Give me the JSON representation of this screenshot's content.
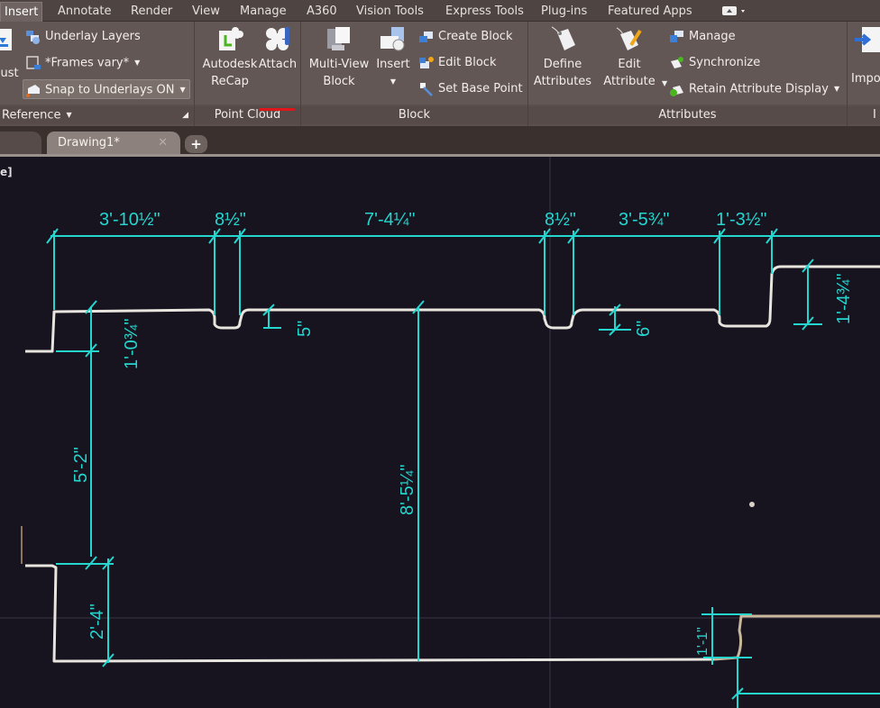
{
  "ribbon_tabs": [
    {
      "label": "Insert",
      "active": true
    },
    {
      "label": "Annotate"
    },
    {
      "label": "Render"
    },
    {
      "label": "View"
    },
    {
      "label": "Manage"
    },
    {
      "label": "A360"
    },
    {
      "label": "Vision Tools"
    },
    {
      "label": "Express Tools"
    },
    {
      "label": "Plug-ins"
    },
    {
      "label": "Featured Apps"
    }
  ],
  "panels": {
    "reference": {
      "title": "Reference",
      "adjust_label": "Adjust",
      "underlay_layers": "Underlay Layers",
      "frames": "*Frames vary*",
      "snap": "Snap to Underlays ON"
    },
    "point_cloud": {
      "title": "Point Cloud",
      "recap_line1": "Autodesk",
      "recap_line2": "ReCap",
      "attach": "Attach"
    },
    "block": {
      "title": "Block",
      "multiview_line1": "Multi-View",
      "multiview_line2": "Block",
      "insert": "Insert",
      "create_block": "Create Block",
      "edit_block": "Edit Block",
      "set_base_point": "Set Base Point"
    },
    "attributes": {
      "title": "Attributes",
      "define_line1": "Define",
      "define_line2": "Attributes",
      "edit_line1": "Edit",
      "edit_line2": "Attribute",
      "manage": "Manage",
      "synchronize": "Synchronize",
      "retain": "Retain Attribute Display"
    },
    "import": {
      "label": "Impo",
      "title": "I"
    }
  },
  "document_tabs": [
    {
      "label": "Drawing1*",
      "active": true
    }
  ],
  "new_tab_label": "+",
  "close_glyph": "✕",
  "viewport_label": "e]",
  "dimensions": {
    "top": [
      "3'-10½\"",
      "8½\"",
      "7'-4¼\"",
      "8½\"",
      "3'-5¾\"",
      "1'-3½\""
    ],
    "left_small": "1'-0¾\"",
    "notch_5": "5\"",
    "notch_6": "6\"",
    "right_step": "1'-4¾\"",
    "left_tall": "5'-2\"",
    "center_tall": "8'-5¼\"",
    "bottom_left": "2'-4\"",
    "bottom_right": "1'-1\""
  },
  "colors": {
    "dimension": "#25d6cf",
    "outline": "#e8e4de",
    "canvas_bg": "#17131f",
    "attach_underline": "#e0161a"
  }
}
